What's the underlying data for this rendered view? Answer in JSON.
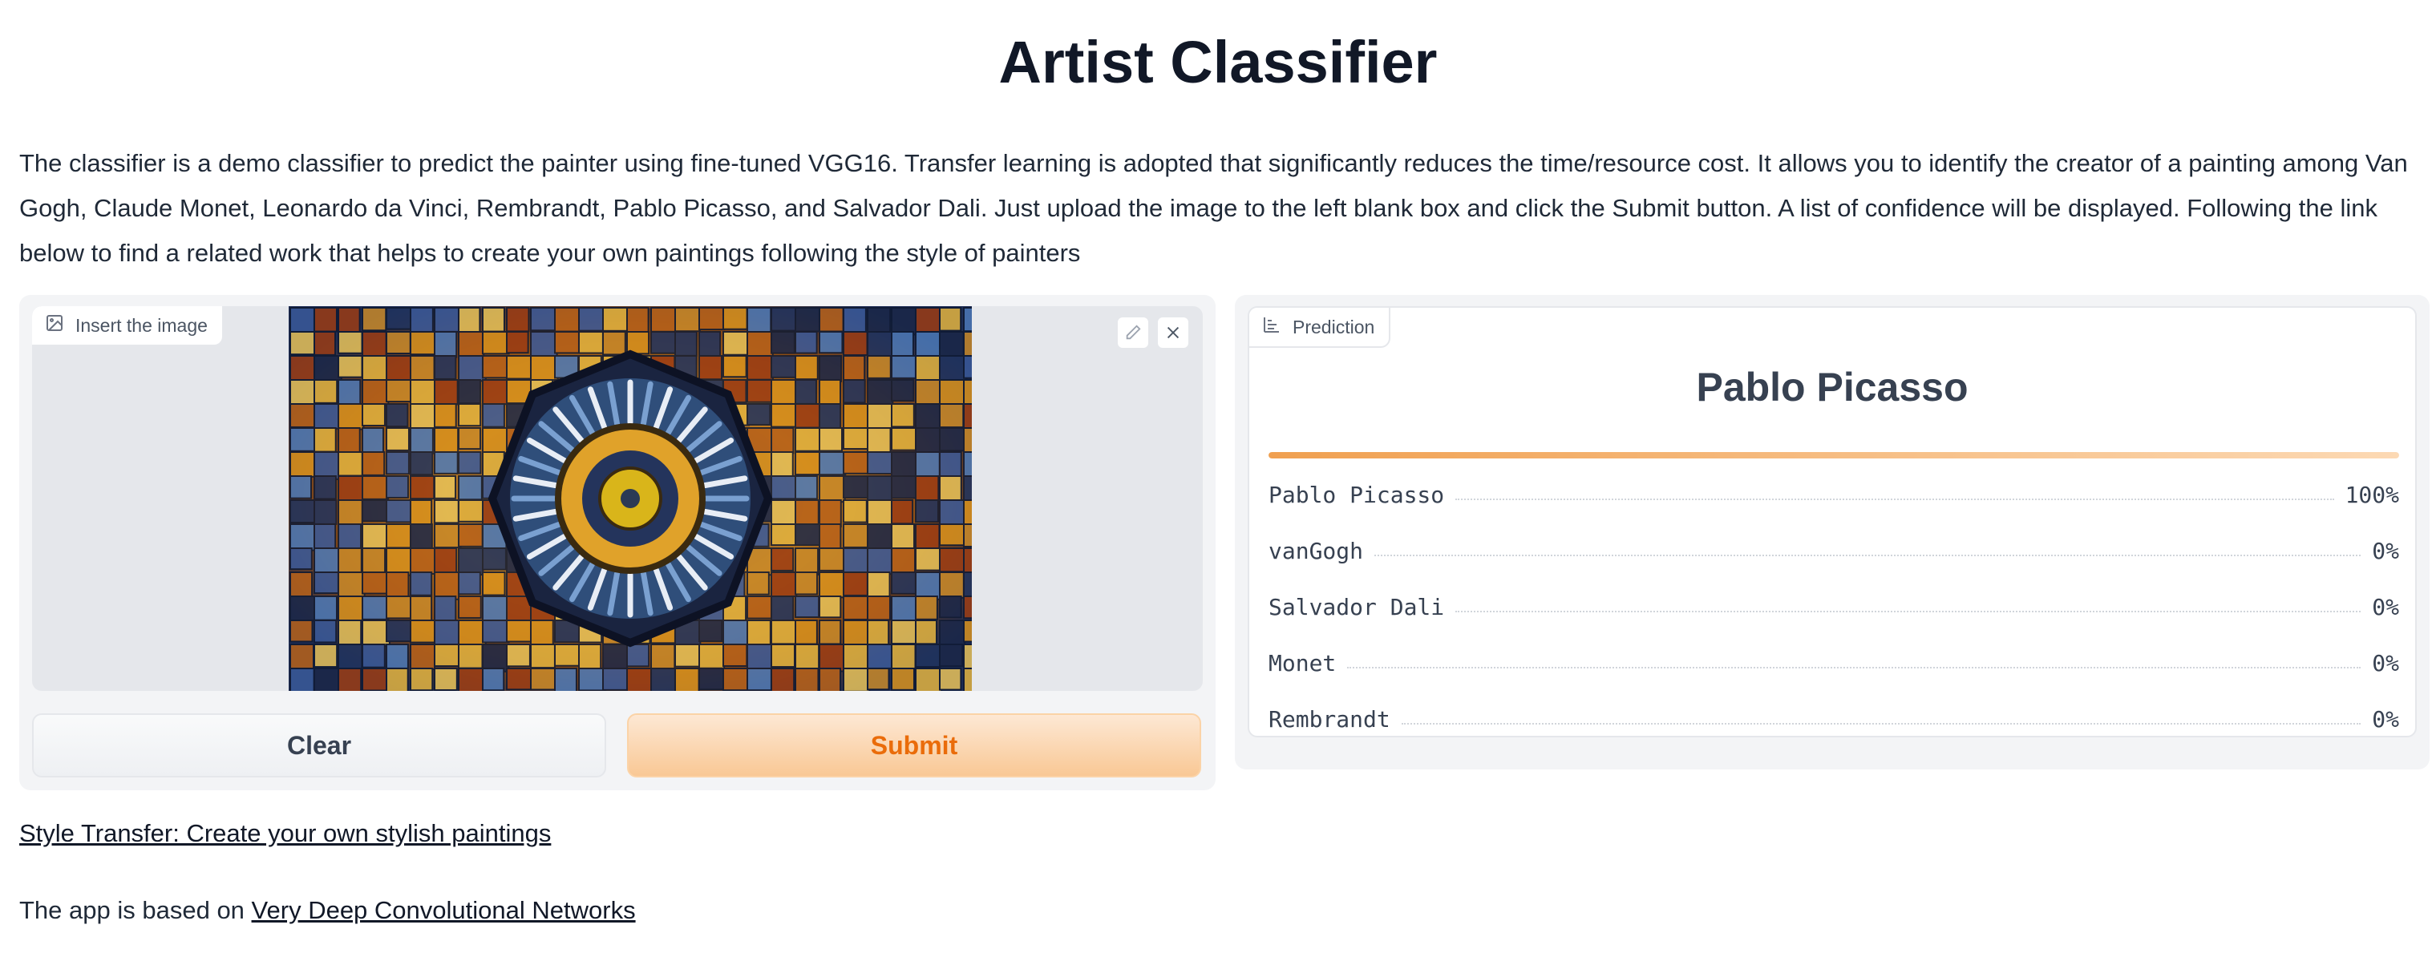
{
  "header": {
    "title": "Artist Classifier",
    "description": "The classifier is a demo classifier to predict the painter using fine-tuned VGG16. Transfer learning is adopted that significantly reduces the time/resource cost. It allows you to identify the creator of a painting among Van Gogh, Claude Monet, Leonardo da Vinci, Rembrandt, Pablo Picasso, and Salvador Dali. Just upload the image to the left blank box and click the Submit button. A list of confidence will be displayed. Following the link below to find a related work that helps to create your own paintings following the style of painters"
  },
  "input": {
    "label": "Insert the image",
    "icon": "image-icon",
    "tools": [
      "pencil-icon",
      "close-icon"
    ],
    "clear_label": "Clear",
    "submit_label": "Submit"
  },
  "output": {
    "label": "Prediction",
    "icon": "bar-chart-icon",
    "top_label": "Pablo Picasso",
    "top_confidence": 1.0,
    "confidences": [
      {
        "label": "Pablo Picasso",
        "value": "100%"
      },
      {
        "label": "vanGogh",
        "value": "0%"
      },
      {
        "label": "Salvador Dali",
        "value": "0%"
      },
      {
        "label": "Monet",
        "value": "0%"
      },
      {
        "label": "Rembrandt",
        "value": "0%"
      }
    ]
  },
  "links": {
    "style_transfer": "Style Transfer: Create your own stylish paintings",
    "footer_prefix": "The app is based on ",
    "footer_link": "Very Deep Convolutional Networks"
  },
  "colors": {
    "accent": "#ea6c0a",
    "submit_bg": "#f9c895",
    "panel_bg": "#f3f4f6"
  }
}
